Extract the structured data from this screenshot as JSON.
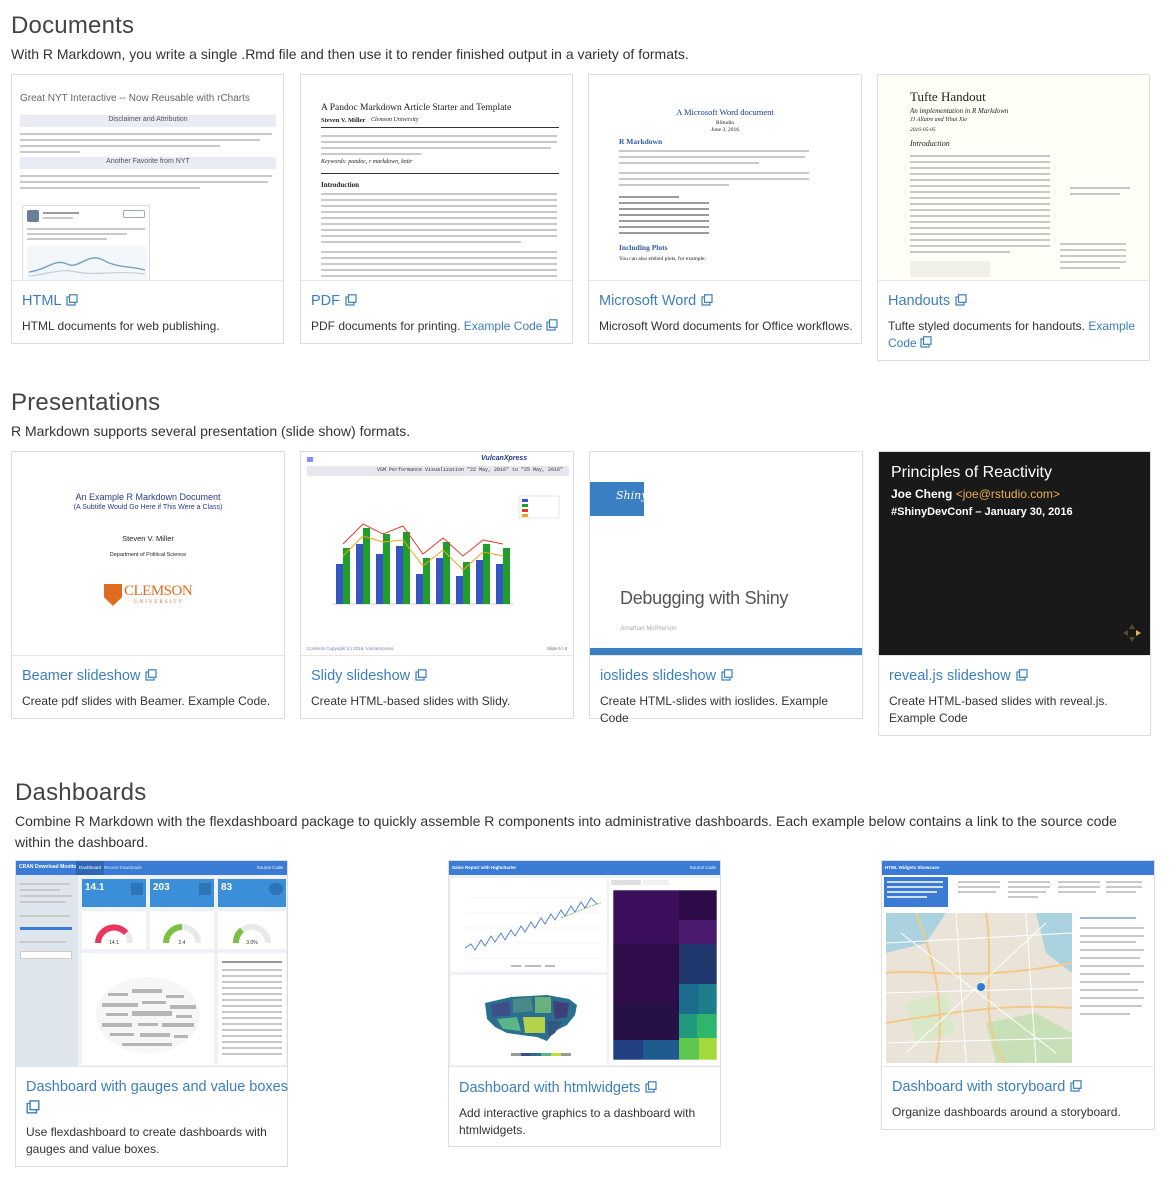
{
  "documents": {
    "title": "Documents",
    "description": "With R Markdown, you write a single .Rmd file and then use it to render finished output in a variety of formats.",
    "cards": [
      {
        "title": "HTML",
        "desc": "HTML documents for web publishing.",
        "link": ""
      },
      {
        "title": "PDF",
        "desc": "PDF documents for printing.",
        "link": "Example Code"
      },
      {
        "title": "Microsoft Word",
        "desc": "Microsoft Word documents for Office workflows.",
        "link": ""
      },
      {
        "title": "Handouts",
        "desc": "Tufte styled documents for handouts.",
        "link": "Example Code"
      }
    ],
    "thumbs": {
      "html_heading": "Great NYT Interactive -- Now Reusable with rCharts",
      "html_sub1": "Disclaimer and Attribution",
      "html_sub2": "Another Favorite from NYT",
      "pdf_title": "A Pandoc Markdown Article Starter and Template",
      "pdf_author": "Steven V. Miller",
      "pdf_affil": "Clemson University",
      "pdf_keywords": "Keywords: pandoc, r markdown, knitr",
      "pdf_intro": "Introduction",
      "word_title": "A Microsoft Word document",
      "word_org": "RStudio",
      "word_date": "June 3, 2016",
      "word_h1": "R Markdown",
      "word_h2": "Including Plots",
      "word_foot": "You can also embed plots, for example:",
      "tufte_title": "Tufte Handout",
      "tufte_sub": "An implementation in R Markdown",
      "tufte_authors": "JJ Allaire and Yihui Xie",
      "tufte_date": "2016-05-05",
      "tufte_intro": "Introduction"
    }
  },
  "presentations": {
    "title": "Presentations",
    "description": "R Markdown supports several presentation (slide show) formats.",
    "cards": [
      {
        "title": "Beamer slideshow",
        "desc": "Create pdf slides with Beamer. Example Code."
      },
      {
        "title": "Slidy slideshow",
        "desc": "Create HTML-based slides with Slidy."
      },
      {
        "title": "ioslides slideshow",
        "desc": "Create HTML-slides with ioslides. Example Code"
      },
      {
        "title": "reveal.js slideshow",
        "desc": "Create HTML-based slides with reveal.js. Example Code"
      }
    ],
    "thumbs": {
      "beamer_title": "An Example R Markdown Document",
      "beamer_sub": "(A Subtitle Would Go Here if This Were a Class)",
      "beamer_author": "Steven V. Miller",
      "beamer_dept": "Department of Political Science",
      "beamer_logo": "CLEMSON",
      "beamer_logo_sub": "UNIVERSITY",
      "slidy_brand": "VulcanXpress",
      "slidy_header": "VSM Performance Visualization \"22 May, 2016\" to \"25 May, 2016\"",
      "slidy_footer": "Contents   Copyright (c) 2016, VulcanXpress",
      "slidy_page": "Slide 5 / 8",
      "ioslides_badge": "Shiny",
      "ioslides_title": "Debugging with Shiny",
      "ioslides_author": "Jonathan McPherson",
      "reveal_title": "Principles of Reactivity",
      "reveal_name": "Joe Cheng",
      "reveal_email": "<joe@rstudio.com>",
      "reveal_conf": "#ShinyDevConf – January 30, 2016"
    }
  },
  "dashboards": {
    "title": "Dashboards",
    "description": "Combine R Markdown with the flexdashboard package to quickly assemble R components into administrative dashboards. Each example below contains a link to the source code within the dashboard.",
    "cards": [
      {
        "title": "Dashboard with gauges and value boxes",
        "desc": "Use flexdashboard to create dashboards with gauges and value boxes."
      },
      {
        "title": "Dashboard with htmlwidgets",
        "desc": "Add interactive graphics to a dashboard with htmlwidgets."
      },
      {
        "title": "Dashboard with storyboard",
        "desc": "Organize dashboards around a storyboard."
      }
    ],
    "thumbs": {
      "d1_brand": "CRAN Download Monitor",
      "d1_tab1": "Dashboard",
      "d1_tab2": "Recent Downloads",
      "d1_source": "Source Code",
      "d1_v1": "14.1",
      "d1_v2": "203",
      "d1_v3": "83",
      "d1_g1": "14.1",
      "d1_g2": "2.4",
      "d1_g3": "3.0%",
      "d2_brand": "Sales Report with Highcharter",
      "d2_source": "Source Code",
      "d3_brand": "HTML Widgets Showcase"
    }
  },
  "colors": {
    "link": "#3c7ebc",
    "dash_navbar": "#3a7bd5",
    "value_box": "#3b8fd8",
    "reveal_bg": "#191919",
    "reveal_accent": "#e7ad52",
    "ioslides_bar": "#3a7fc1"
  },
  "icons": {
    "external_link": "external-link-icon"
  }
}
